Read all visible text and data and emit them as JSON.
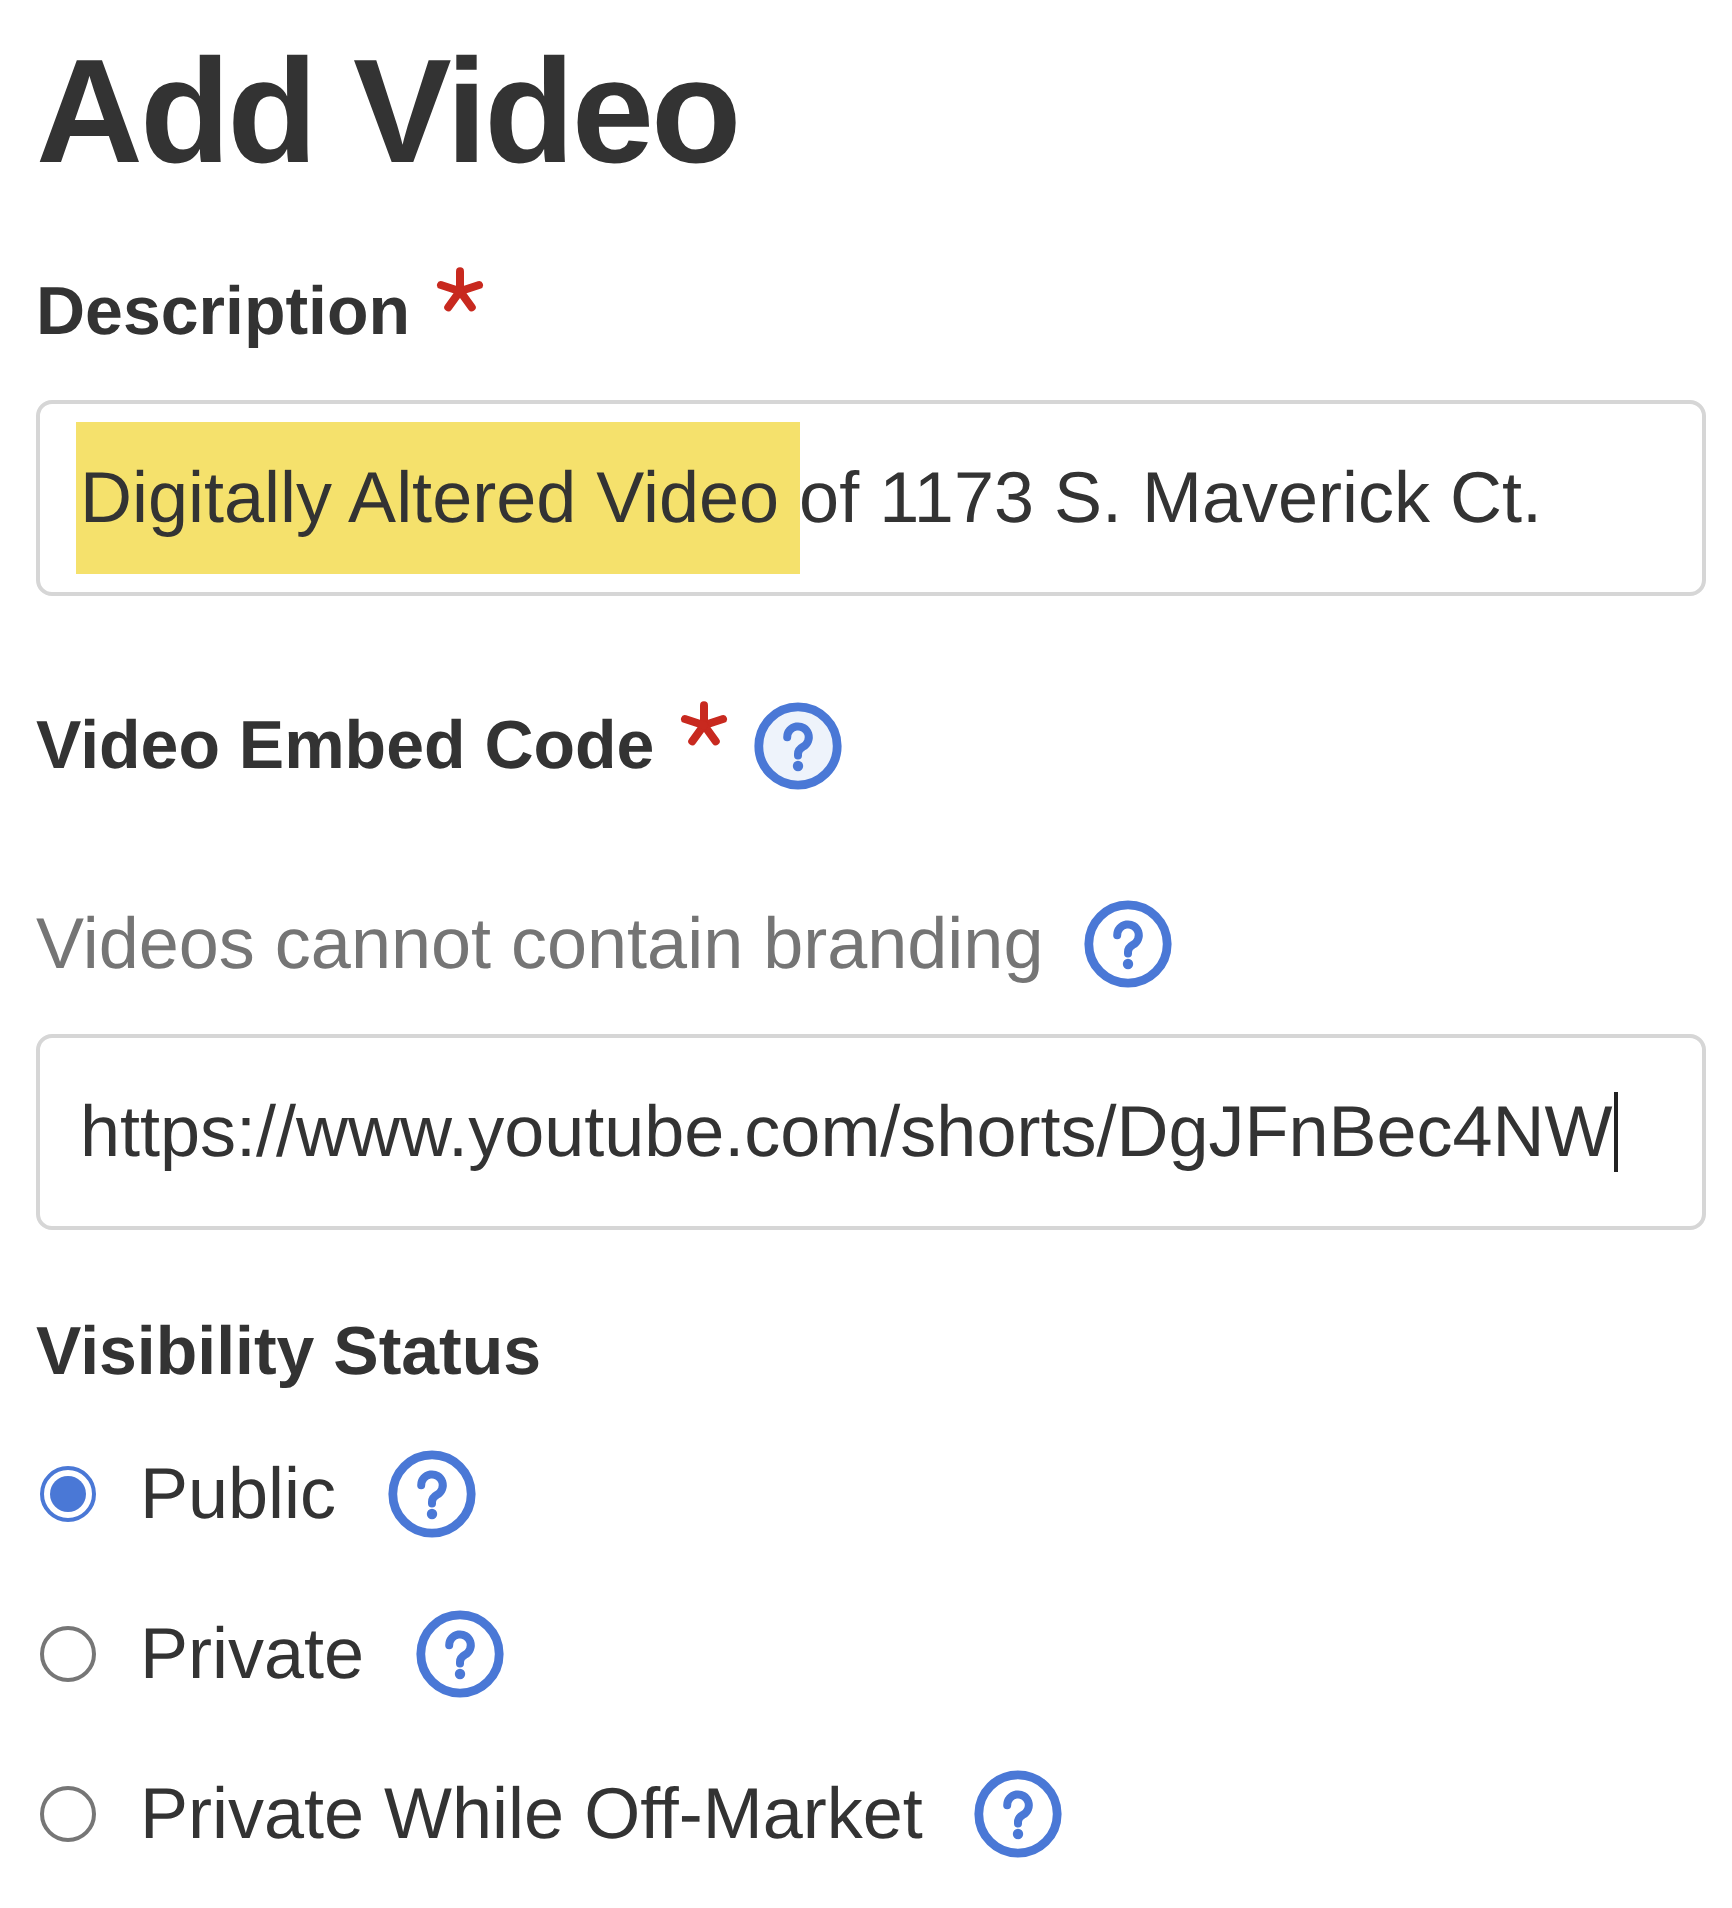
{
  "title": "Add Video",
  "description": {
    "label": "Description",
    "required": true,
    "value": [
      {
        "text": "Digitally Altered Video ",
        "highlighted": true
      },
      {
        "text": "of 1173 S. Maverick Ct.",
        "highlighted": false
      }
    ]
  },
  "video_embed_code": {
    "label": "Video Embed Code",
    "required": true,
    "help": true,
    "hint": "Videos cannot contain branding",
    "hint_help": true,
    "value": "https://www.youtube.com/shorts/DgJFnBec4NW",
    "focused": true
  },
  "visibility_status": {
    "label": "Visibility Status",
    "options": [
      {
        "label": "Public",
        "selected": true,
        "help": true
      },
      {
        "label": "Private",
        "selected": false,
        "help": true
      },
      {
        "label": "Private While Off-Market",
        "selected": false,
        "help": true
      }
    ]
  }
}
